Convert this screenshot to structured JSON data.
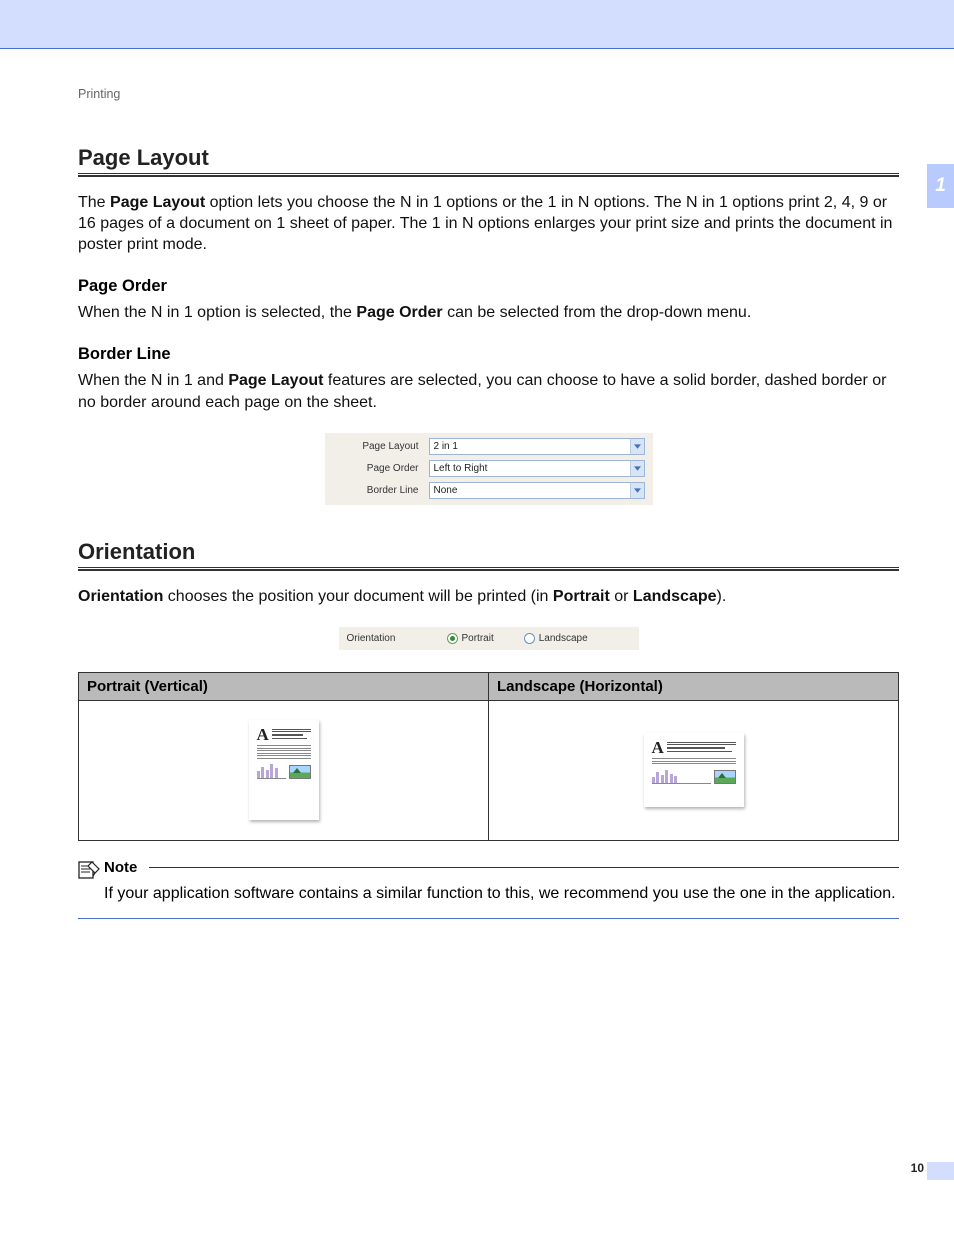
{
  "chapter_tab": "1",
  "page_number": "10",
  "breadcrumb": "Printing",
  "sections": {
    "page_layout": {
      "title": "Page Layout",
      "intro_parts": {
        "pre": "The ",
        "bold1": "Page Layout",
        "post": " option lets you choose the N in 1 options or the 1 in N options. The N in 1 options print 2, 4, 9 or 16 pages of a document on 1 sheet of paper. The 1 in N options enlarges your print size and prints the document in poster print mode."
      },
      "page_order": {
        "heading": "Page Order",
        "text_parts": {
          "pre": "When the N in 1 option is selected, the ",
          "bold": "Page Order",
          "post": " can be selected from the drop-down menu."
        }
      },
      "border_line": {
        "heading": "Border Line",
        "text_parts": {
          "pre": "When the N in 1 and ",
          "bold": "Page Layout",
          "post": " features are selected, you can choose to have a solid border, dashed border or no border around each page on the sheet."
        }
      },
      "driver_panel": {
        "rows": [
          {
            "label": "Page Layout",
            "value": "2 in 1"
          },
          {
            "label": "Page Order",
            "value": "Left to Right"
          },
          {
            "label": "Border Line",
            "value": "None"
          }
        ]
      }
    },
    "orientation": {
      "title": "Orientation",
      "intro_parts": {
        "bold1": "Orientation",
        "mid": " chooses the position your document will be printed (in ",
        "bold2": "Portrait",
        "mid2": " or ",
        "bold3": "Landscape",
        "post": ")."
      },
      "radio_panel": {
        "label": "Orientation",
        "options": [
          {
            "label": "Portrait",
            "checked": true
          },
          {
            "label": "Landscape",
            "checked": false
          }
        ]
      },
      "table": {
        "col1": "Portrait (Vertical)",
        "col2": "Landscape (Horizontal)"
      },
      "note": {
        "label": "Note",
        "text": "If your application software contains a similar function to this, we recommend you use the one in the application."
      }
    }
  }
}
